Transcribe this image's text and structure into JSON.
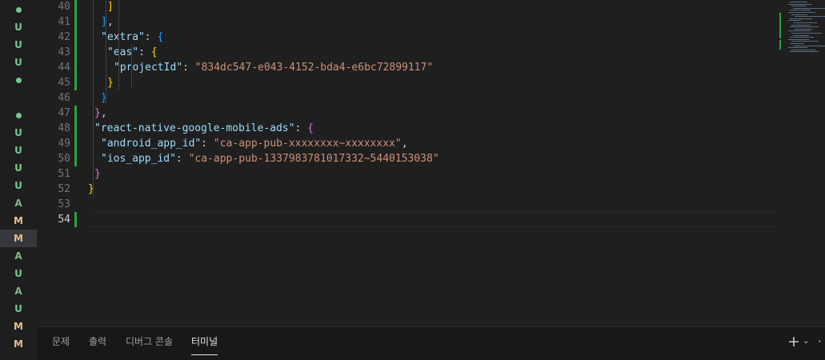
{
  "git_status": [
    "dot",
    "U",
    "U",
    "U",
    "dot",
    "",
    "dot",
    "U",
    "U",
    "U",
    "U",
    "A",
    "M",
    "M",
    "A",
    "U",
    "A",
    "U",
    "M",
    "M"
  ],
  "git_selected_index": 13,
  "colors": {
    "untracked": "#73c991",
    "added": "#81b88b",
    "modified": "#e2c08d",
    "dot": "#73c991",
    "gitbar": "#2ea043"
  },
  "editor": {
    "current_line": 54,
    "lines": [
      {
        "n": 40,
        "tokens": [
          {
            "c": "b1",
            "t": "]"
          }
        ]
      },
      {
        "n": 41,
        "tokens": [
          {
            "c": "b3",
            "t": "]"
          },
          {
            "c": "tok-punc",
            "t": ","
          }
        ]
      },
      {
        "n": 42,
        "tokens": [
          {
            "c": "tok-key",
            "t": "\"extra\""
          },
          {
            "c": "tok-punc",
            "t": ": "
          },
          {
            "c": "b3",
            "t": "{"
          }
        ]
      },
      {
        "n": 43,
        "tokens": [
          {
            "c": "tok-key",
            "t": "\"eas\""
          },
          {
            "c": "tok-punc",
            "t": ": "
          },
          {
            "c": "b1",
            "t": "{"
          }
        ]
      },
      {
        "n": 44,
        "tokens": [
          {
            "c": "tok-key",
            "t": "\"projectId\""
          },
          {
            "c": "tok-punc",
            "t": ": "
          },
          {
            "c": "tok-str",
            "t": "\"834dc547-e043-4152-bda4-e6bc72899117\""
          }
        ]
      },
      {
        "n": 45,
        "tokens": [
          {
            "c": "b1",
            "t": "}"
          }
        ]
      },
      {
        "n": 46,
        "tokens": [
          {
            "c": "b3",
            "t": "}"
          }
        ]
      },
      {
        "n": 47,
        "tokens": [
          {
            "c": "b2",
            "t": "}"
          },
          {
            "c": "tok-punc",
            "t": ","
          }
        ]
      },
      {
        "n": 48,
        "tokens": [
          {
            "c": "tok-key",
            "t": "\"react-native-google-mobile-ads\""
          },
          {
            "c": "tok-punc",
            "t": ": "
          },
          {
            "c": "b2",
            "t": "{"
          }
        ]
      },
      {
        "n": 49,
        "tokens": [
          {
            "c": "tok-key",
            "t": "\"android_app_id\""
          },
          {
            "c": "tok-punc",
            "t": ": "
          },
          {
            "c": "tok-str",
            "t": "\"ca-app-pub-xxxxxxxx~xxxxxxxx\""
          },
          {
            "c": "tok-punc",
            "t": ","
          }
        ]
      },
      {
        "n": 50,
        "tokens": [
          {
            "c": "tok-key",
            "t": "\"ios_app_id\""
          },
          {
            "c": "tok-punc",
            "t": ": "
          },
          {
            "c": "tok-str",
            "t": "\"ca-app-pub-1337983781017332~5440153038\""
          }
        ]
      },
      {
        "n": 51,
        "tokens": [
          {
            "c": "b2",
            "t": "}"
          }
        ]
      },
      {
        "n": 52,
        "tokens": [
          {
            "c": "b1",
            "t": "}"
          }
        ]
      },
      {
        "n": 53,
        "tokens": []
      },
      {
        "n": 54,
        "tokens": []
      }
    ]
  },
  "panel": {
    "tabs": [
      {
        "label": "문제",
        "active": false
      },
      {
        "label": "출력",
        "active": false
      },
      {
        "label": "디버그 콘솔",
        "active": false
      },
      {
        "label": "터미널",
        "active": true
      }
    ],
    "icons": [
      "plus-icon",
      "chevron-down-icon",
      "more-icon"
    ]
  }
}
